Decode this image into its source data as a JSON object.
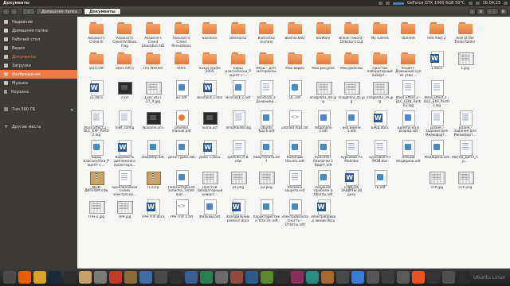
{
  "window": {
    "title": "Документы"
  },
  "topbar": {
    "status": "GeForce GTX 1060 6GB 50°C",
    "clock": "16:04:23"
  },
  "toolbar": {
    "back": "‹",
    "forward": "›",
    "crumbs": [
      "‹",
      "Домашняя папка",
      "Документы"
    ],
    "search": "⌕",
    "view_list": "≡",
    "view_grid": "⋮⋮",
    "menu": "⚙"
  },
  "sidebar": {
    "items": [
      {
        "label": "Недавние",
        "icon": "clock-icon"
      },
      {
        "label": "Домашняя папка",
        "icon": "home-icon"
      },
      {
        "label": "Рабочий стол",
        "icon": "desktop-icon"
      },
      {
        "label": "Видео",
        "icon": "video-icon"
      },
      {
        "label": "Документы",
        "icon": "documents-icon",
        "active": true
      },
      {
        "label": "Загрузки",
        "icon": "download-icon"
      },
      {
        "label": "Изображения",
        "icon": "pictures-icon",
        "highlight": true
      },
      {
        "label": "Музыка",
        "icon": "music-icon"
      },
      {
        "label": "Корзина",
        "icon": "trash-icon"
      },
      {
        "label": "",
        "icon": ""
      },
      {
        "label": "Том 500 ГБ",
        "icon": "disk-icon",
        "eject": true
      },
      {
        "label": "",
        "icon": ""
      },
      {
        "label": "Другие места",
        "icon": "plus-icon"
      }
    ]
  },
  "files": [
    {
      "name": "Assassin's Creed III",
      "type": "folder"
    },
    {
      "name": "Assassin's Creed IV Black Flag",
      "type": "folder"
    },
    {
      "name": "Assassin's Creed Liberation HD",
      "type": "folder"
    },
    {
      "name": "Assassin's Creed Revelations",
      "type": "folder"
    },
    {
      "name": "Bioshock",
      "type": "folder"
    },
    {
      "name": "Bioshock2",
      "type": "folder"
    },
    {
      "name": "Bioshock2 (копия)",
      "type": "folder"
    },
    {
      "name": "BioshockHD",
      "type": "folder"
    },
    {
      "name": "BioWare",
      "type": "folder"
    },
    {
      "name": "Broken Sword - Director's Cut",
      "type": "folder"
    },
    {
      "name": "My Games",
      "type": "folder"
    },
    {
      "name": "OpenRA",
      "type": "folder"
    },
    {
      "name": "Red Alert 2",
      "type": "folder"
    },
    {
      "name": "Rise of the Tomb Raider",
      "type": "folder"
    },
    {
      "name": "",
      "type": "empty"
    },
    {
      "name": "Starcraft",
      "type": "folder"
    },
    {
      "name": "StarCraft II",
      "type": "folder"
    },
    {
      "name": "The Witcher",
      "type": "folder"
    },
    {
      "name": "titles",
      "type": "folder"
    },
    {
      "name": "Visual Studio 2005",
      "type": "folder"
    },
    {
      "name": "Борщ классически_Рецепт с ...",
      "type": "folder"
    },
    {
      "name": "Игры - Доп. материалы",
      "type": "folder"
    },
    {
      "name": "Мои видео",
      "type": "folder"
    },
    {
      "name": "Мои рисунки",
      "type": "folder"
    },
    {
      "name": "Мои фильмы",
      "type": "folder"
    },
    {
      "name": "Простой лабораторный инверт...",
      "type": "folder"
    },
    {
      "name": "Рецепт: Домашний суп из утки ...",
      "type": "folder"
    },
    {
      "name": "1.docx",
      "type": "word"
    },
    {
      "name": "1.jpg",
      "type": "img"
    },
    {
      "name": "",
      "type": "empty"
    },
    {
      "name": "11.docx",
      "type": "word"
    },
    {
      "name": "3.xcf",
      "type": "dark"
    },
    {
      "name": "13073437 27_9.jpg",
      "type": "img"
    },
    {
      "name": "B2.odt",
      "type": "odt"
    },
    {
      "name": "Bioshock 2.doc",
      "type": "word"
    },
    {
      "name": "Bioshock 2.odt",
      "type": "odt"
    },
    {
      "name": "Bioshock 2 Дневники...",
      "type": "doc"
    },
    {
      "name": "DC.odt",
      "type": "odt"
    },
    {
      "name": "image001_84.jpg",
      "type": "img"
    },
    {
      "name": "image002_45.jpg",
      "type": "img"
    },
    {
      "name": "image003_39.jpg",
      "type": "img"
    },
    {
      "name": "Mass Effect 2 - DLC_CON_Pack02.log",
      "type": "doc"
    },
    {
      "name": "Mass Effect 2 - DLC_EXP_Part01.log",
      "type": "doc"
    },
    {
      "name": "",
      "type": "empty"
    },
    {
      "name": "",
      "type": "empty"
    },
    {
      "name": "Mass Effect 2 - DLC_EXP_Part02.log",
      "type": "doc"
    },
    {
      "name": "mwf_config",
      "type": "doc"
    },
    {
      "name": "Noname.scn",
      "type": "dark"
    },
    {
      "name": "phoenix manual.pdf",
      "type": "orange"
    },
    {
      "name": "Soma.xcf",
      "type": "dark"
    },
    {
      "name": "TombRaider.log",
      "type": "doc"
    },
    {
      "name": "Ubuntu Touch.odt",
      "type": "odt"
    },
    {
      "name": "untitled.mp4.txt",
      "type": "text"
    },
    {
      "name": "Yotaphone 3.odt",
      "type": "odt"
    },
    {
      "name": "Без имени 1.odt",
      "type": "odt"
    },
    {
      "name": "БЖД.docx",
      "type": "word"
    },
    {
      "name": "Билеты на 8 разряд.odt",
      "type": "odt"
    },
    {
      "name": "Бланк_ Задание для Ижмофорт...",
      "type": "doc"
    },
    {
      "name": "Бланк_ Задание для Ижмофорт...",
      "type": "doc"
    },
    {
      "name": "",
      "type": "empty"
    },
    {
      "name": "Борщ классически_Рецепт с ...",
      "type": "odt"
    },
    {
      "name": "Ведомость дипломного проектиро...",
      "type": "word"
    },
    {
      "name": "Водомер.odt",
      "type": "odt"
    },
    {
      "name": "День сурка.odt",
      "type": "odt"
    },
    {
      "name": "дина 1.docx",
      "type": "word"
    },
    {
      "name": "Зубенко А.В. cdw",
      "type": "doc"
    },
    {
      "name": "Квартплата.odt",
      "type": "odt"
    },
    {
      "name": "Команды Ubuntu.odt",
      "type": "odt"
    },
    {
      "name": "Конспект биологии 1 Бидет.odt",
      "type": "odt"
    },
    {
      "name": "курсовой РЗ Мой.doc",
      "type": "doc"
    },
    {
      "name": "курсовой РЗ МОЙ.doc",
      "type": "doc"
    },
    {
      "name": "Лекции медицина.odt",
      "type": "odt"
    },
    {
      "name": "Медицина.odt",
      "type": "odt"
    },
    {
      "name": "Метод_Дипл_пр...",
      "type": "doc"
    },
    {
      "name": "",
      "type": "empty"
    },
    {
      "name": "МОЙ ДИПЛОМ.cdw",
      "type": "zip"
    },
    {
      "name": "однолинейная схема электросна...",
      "type": "doc"
    },
    {
      "name": "П.3.zip",
      "type": "zip"
    },
    {
      "name": "Пояснительная записка_Тепловой ...",
      "type": "odt"
    },
    {
      "name": "Простой лабораторный инверт...",
      "type": "img"
    },
    {
      "name": "р1.png",
      "type": "img"
    },
    {
      "name": "р2.png",
      "type": "img"
    },
    {
      "name": "Релейна защита.vsd",
      "type": "doc"
    },
    {
      "name": "Решение проблем в Ubuntu.odt",
      "type": "odt"
    },
    {
      "name": "СПИСОК ЗАЩИТЫ 30 докх",
      "type": "word"
    },
    {
      "name": "ТБ.odt",
      "type": "odt"
    },
    {
      "name": "",
      "type": "empty"
    },
    {
      "name": "ТПУ.jpg",
      "type": "img"
    },
    {
      "name": "ТПУ.png",
      "type": "img"
    },
    {
      "name": "",
      "type": "empty"
    },
    {
      "name": "ТПН-2.jpg",
      "type": "img"
    },
    {
      "name": "ТРН.jpg",
      "type": "img"
    },
    {
      "name": "ТРН-ТПУ.docx",
      "type": "word"
    },
    {
      "name": "ТРН-ТПУ 1.txt",
      "type": "text"
    },
    {
      "name": "Фильмы.odt",
      "type": "odt"
    },
    {
      "name": "Холодильник ремонт.docx",
      "type": "word"
    },
    {
      "name": "Характеристики Yota 3+.odt",
      "type": "odt"
    },
    {
      "name": "Электробезопасность - Ответы.odt",
      "type": "odt"
    },
    {
      "name": "Электропривод линии.docx",
      "type": "word"
    }
  ],
  "dock": {
    "apps": [
      {
        "name": "ubuntu-icon",
        "color": "#4a4a4a"
      },
      {
        "name": "firefox-icon",
        "color": "#e66000"
      },
      {
        "name": "chrome-icon",
        "color": "#d8a427"
      },
      {
        "name": "steam-icon",
        "color": "#1b2838"
      },
      {
        "name": "terminal-icon",
        "color": "#2d2d2d"
      },
      {
        "name": "files-icon",
        "color": "#c2a36c"
      },
      {
        "name": "settings-icon",
        "color": "#7a7a7a"
      },
      {
        "name": "ring-icon",
        "color": "#c0392b"
      },
      {
        "name": "files-icon",
        "color": "#8a6d3d"
      },
      {
        "name": "app-icon",
        "color": "#3b6ea5"
      },
      {
        "name": "app-icon",
        "color": "#4a4a4a"
      },
      {
        "name": "obs-icon",
        "color": "#302e2e"
      },
      {
        "name": "app-icon",
        "color": "#3b5e91"
      },
      {
        "name": "app-icon",
        "color": "#2c7d4f"
      },
      {
        "name": "app-icon",
        "color": "#6b6b6b"
      },
      {
        "name": "app-icon",
        "color": "#914a3b"
      },
      {
        "name": "app-icon",
        "color": "#2e5a8a"
      },
      {
        "name": "app-icon",
        "color": "#5b8a2e"
      },
      {
        "name": "terminal-icon",
        "color": "#2d2d2d"
      },
      {
        "name": "app-icon",
        "color": "#8a2e5a"
      },
      {
        "name": "app-icon",
        "color": "#2e8a80"
      },
      {
        "name": "app-icon",
        "color": "#a56b2e"
      },
      {
        "name": "app-icon",
        "color": "#4a4a4a"
      },
      {
        "name": "app-icon",
        "color": "#3a7bd5"
      },
      {
        "name": "app-icon",
        "color": "#555"
      },
      {
        "name": "app-icon",
        "color": "#3d3d3d"
      },
      {
        "name": "app-icon",
        "color": "#5a5a5a"
      },
      {
        "name": "app-icon",
        "color": "#e95420"
      },
      {
        "name": "app-icon",
        "color": "#333"
      },
      {
        "name": "app-icon",
        "color": "#4f4f4f"
      },
      {
        "name": "app-icon",
        "color": "#2b2b2b"
      }
    ],
    "watermark": "Ubuntu Linux"
  },
  "colors": {
    "accent": "#f07746",
    "folder": "#f4a56a",
    "word": "#2b5797"
  }
}
